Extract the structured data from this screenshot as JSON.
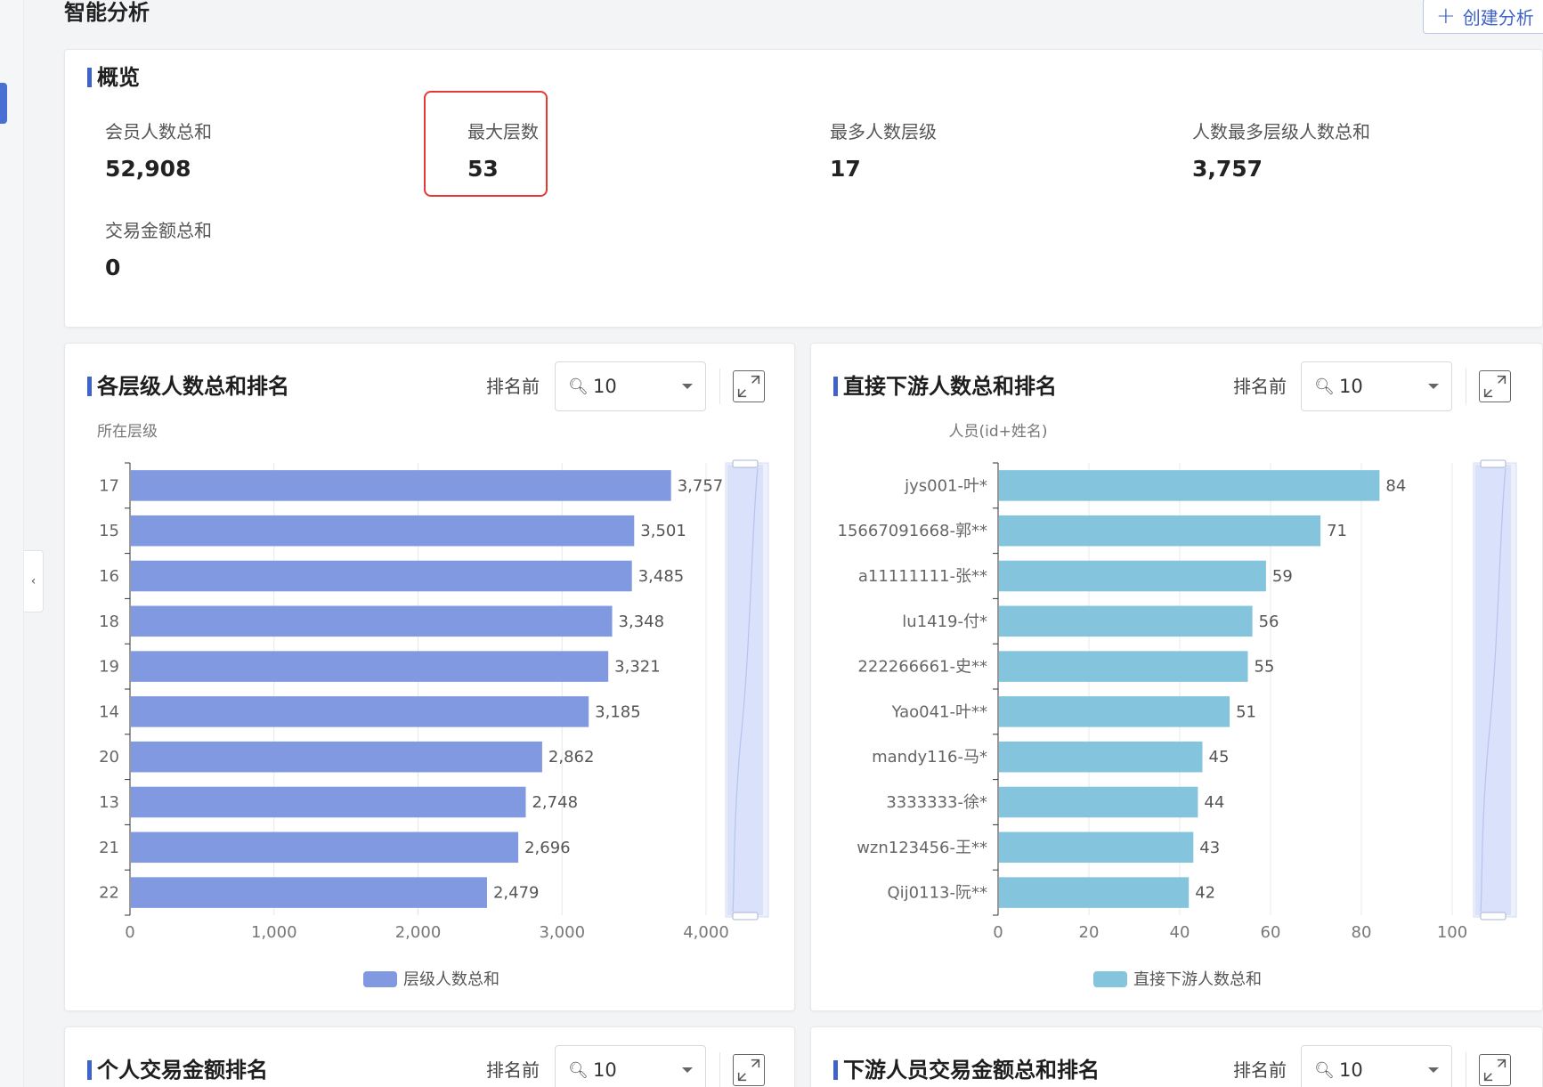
{
  "page": {
    "title": "智能分析",
    "create_button": "创建分析"
  },
  "overview": {
    "title": "概览",
    "stats": [
      {
        "label": "会员人数总和",
        "value": "52,908"
      },
      {
        "label": "最大层数",
        "value": "53"
      },
      {
        "label": "最多人数层级",
        "value": "17"
      },
      {
        "label": "人数最多层级人数总和",
        "value": "3,757"
      },
      {
        "label": "交易金额总和",
        "value": "0"
      }
    ]
  },
  "controls": {
    "rank_label": "排名前",
    "rank_value": "10"
  },
  "panels": {
    "level_rank": {
      "title": "各层级人数总和排名"
    },
    "downstream_rank": {
      "title": "直接下游人数总和排名"
    },
    "personal_trade": {
      "title": "个人交易金额排名"
    },
    "downstream_trade": {
      "title": "下游人员交易金额总和排名"
    }
  },
  "chart_data": [
    {
      "type": "bar",
      "orientation": "horizontal",
      "ylabel": "所在层级",
      "categories": [
        "17",
        "15",
        "16",
        "18",
        "19",
        "14",
        "20",
        "13",
        "21",
        "22"
      ],
      "series": [
        {
          "name": "层级人数总和",
          "values": [
            3757,
            3501,
            3485,
            3348,
            3321,
            3185,
            2862,
            2748,
            2696,
            2479
          ],
          "color": "#8199e0"
        }
      ],
      "data_labels": [
        "3,757",
        "3,501",
        "3,485",
        "3,348",
        "3,321",
        "3,185",
        "2,862",
        "2,748",
        "2,696",
        "2,479"
      ],
      "xticks": [
        0,
        1000,
        2000,
        3000,
        4000
      ],
      "xtick_labels": [
        "0",
        "1,000",
        "2,000",
        "3,000",
        "4,000"
      ],
      "xlim": [
        0,
        4000
      ],
      "grid": true,
      "legend": "bottom-center"
    },
    {
      "type": "bar",
      "orientation": "horizontal",
      "ylabel": "人员(id+姓名)",
      "categories": [
        "jys001-叶*",
        "15667091668-郭**",
        "a11111111-张**",
        "lu1419-付*",
        "222266661-史**",
        "Yao041-叶**",
        "mandy116-马*",
        "3333333-徐*",
        "wzn123456-王**",
        "Qij0113-阮**"
      ],
      "series": [
        {
          "name": "直接下游人数总和",
          "values": [
            84,
            71,
            59,
            56,
            55,
            51,
            45,
            44,
            43,
            42
          ],
          "color": "#84c4dc"
        }
      ],
      "data_labels": [
        "84",
        "71",
        "59",
        "56",
        "55",
        "51",
        "45",
        "44",
        "43",
        "42"
      ],
      "xticks": [
        0,
        20,
        40,
        60,
        80,
        100
      ],
      "xtick_labels": [
        "0",
        "20",
        "40",
        "60",
        "80",
        "100"
      ],
      "xlim": [
        0,
        100
      ],
      "grid": true,
      "legend": "bottom-center"
    }
  ]
}
